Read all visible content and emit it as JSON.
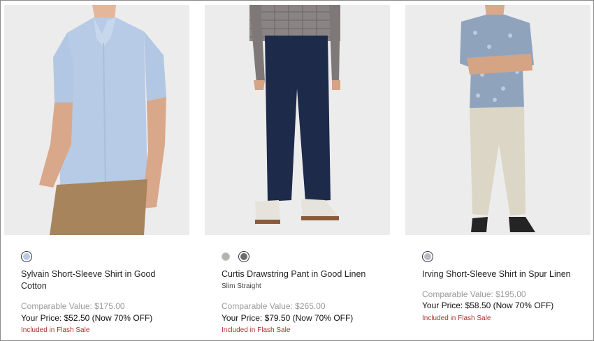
{
  "products": [
    {
      "name": "Sylvain Short-Sleeve Shirt in Good Cotton",
      "subtitle": "",
      "comparable": "Comparable Value: $175.00",
      "your_price": "Your Price: $52.50 (Now 70% OFF)",
      "promo": "Included in Flash Sale",
      "swatches": [
        "#b7cbe4"
      ]
    },
    {
      "name": "Curtis Drawstring Pant in Good Linen",
      "subtitle": "Slim Straight",
      "comparable": "Comparable Value: $265.00",
      "your_price": "Your Price: $79.50 (Now 70% OFF)",
      "promo": "Included in Flash Sale",
      "swatches": [
        "#b5b1ab",
        "#6d6d6d"
      ]
    },
    {
      "name": "Irving Short-Sleeve Shirt in Spur Linen",
      "subtitle": "",
      "comparable": "Comparable Value: $195.00",
      "your_price": "Your Price: $58.50 (Now 70% OFF)",
      "promo": "Included in Flash Sale",
      "swatches": [
        "#b8bcc7"
      ]
    }
  ],
  "colors": {
    "photo_bg": "#ececec",
    "promo": "#a8322d",
    "comparable": "#9a9a9a"
  }
}
